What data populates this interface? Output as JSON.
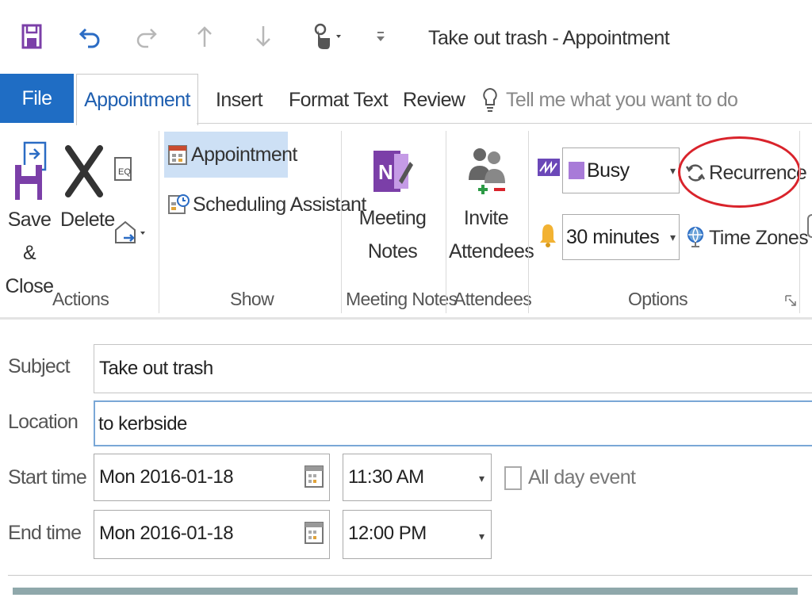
{
  "window": {
    "title": "Take out trash - Appointment"
  },
  "quick_access": {
    "save_icon": "save-icon",
    "undo_icon": "undo-icon",
    "redo_icon": "redo-icon",
    "up_icon": "arrow-up-icon",
    "down_icon": "arrow-down-icon",
    "touch_icon": "touch-mode-icon",
    "customize_icon": "customize-icon"
  },
  "tabs": [
    {
      "label": "File"
    },
    {
      "label": "Appointment"
    },
    {
      "label": "Insert"
    },
    {
      "label": "Format Text"
    },
    {
      "label": "Review"
    }
  ],
  "tell_me": {
    "placeholder": "Tell me what you want to do"
  },
  "ribbon": {
    "actions": {
      "save_close_line1": "Save &",
      "save_close_line2": "Close",
      "delete": "Delete",
      "group_label": "Actions"
    },
    "show": {
      "appointment": "Appointment",
      "scheduling_assistant": "Scheduling Assistant",
      "group_label": "Show"
    },
    "meeting_notes": {
      "line1": "Meeting",
      "line2": "Notes",
      "group_label": "Meeting Notes"
    },
    "attendees": {
      "line1": "Invite",
      "line2": "Attendees",
      "group_label": "Attendees"
    },
    "options": {
      "show_as": "Busy",
      "reminder": "30 minutes",
      "recurrence": "Recurrence",
      "time_zones": "Time Zones",
      "group_label": "Options"
    }
  },
  "form": {
    "subject_label": "Subject",
    "subject_value": "Take out trash",
    "location_label": "Location",
    "location_value": "to kerbside",
    "start_label": "Start time",
    "start_date": "Mon 2016-01-18",
    "start_time": "11:30 AM",
    "all_day_label": "All day event",
    "all_day_checked": false,
    "end_label": "End time",
    "end_date": "Mon 2016-01-18",
    "end_time": "12:00 PM"
  },
  "colors": {
    "file_tab": "#1f6dc4",
    "active_tab_text": "#1f5fb0",
    "busy_swatch": "#a87bd8",
    "highlight_circle": "#d9232b",
    "selected_button": "#cde0f5",
    "footer_bar": "#8fa8ab"
  }
}
